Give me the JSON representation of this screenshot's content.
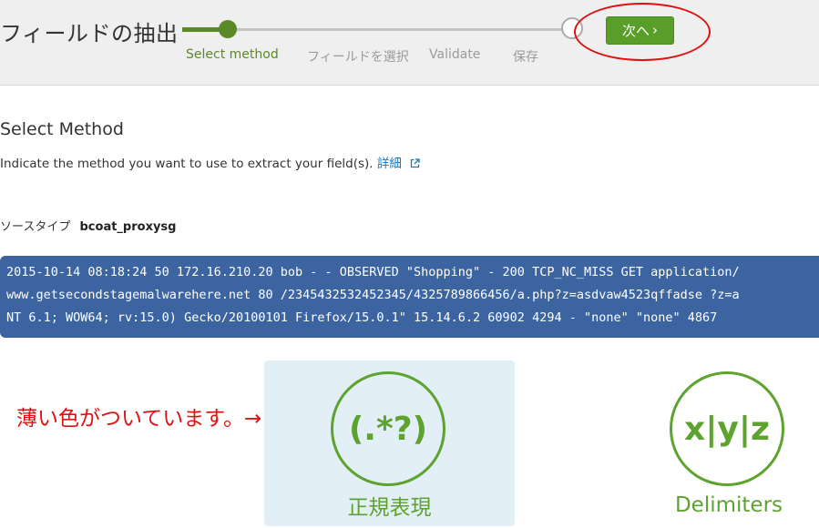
{
  "header": {
    "title": "フィールドの抽出",
    "steps": [
      {
        "label": "Select method",
        "state": "active"
      },
      {
        "label": "フィールドを選択",
        "state": "pending"
      },
      {
        "label": "Validate",
        "state": "pending"
      },
      {
        "label": "保存",
        "state": "pending"
      }
    ],
    "next_button": {
      "label": "次へ",
      "chevron": "›"
    }
  },
  "main": {
    "section_title": "Select Method",
    "description": "Indicate the method you want to use to extract your field(s).",
    "details_link": "詳細",
    "sourcetype_label": "ソースタイプ",
    "sourcetype_value": "bcoat_proxysg",
    "sample_event": [
      "2015-10-14 08:18:24 50 172.16.210.20 bob - - OBSERVED \"Shopping\" - 200 TCP_NC_MISS GET application/",
      "www.getsecondstagemalwarehere.net 80 /2345432532452345/4325789866456/a.php?z=asdvaw4523qffadse ?z=a",
      "NT 6.1; WOW64; rv:15.0) Gecko/20100101 Firefox/15.0.1\" 15.14.6.2 60902 4294 - \"none\" \"none\" 4867"
    ]
  },
  "methods": [
    {
      "icon_text": "(.*?)",
      "label": "正規表現",
      "selected": true
    },
    {
      "icon_text": "x|y|z",
      "label": "Delimiters",
      "selected": false
    }
  ],
  "annotation": {
    "note": "薄い色がついています。→"
  },
  "colors": {
    "accent_green": "#5a8a28",
    "method_green": "#5ea22f",
    "sample_bg": "#3b64a0",
    "selected_card_bg": "#e2eff6",
    "link_blue": "#1a76c2",
    "annotation_red": "#e01010"
  }
}
